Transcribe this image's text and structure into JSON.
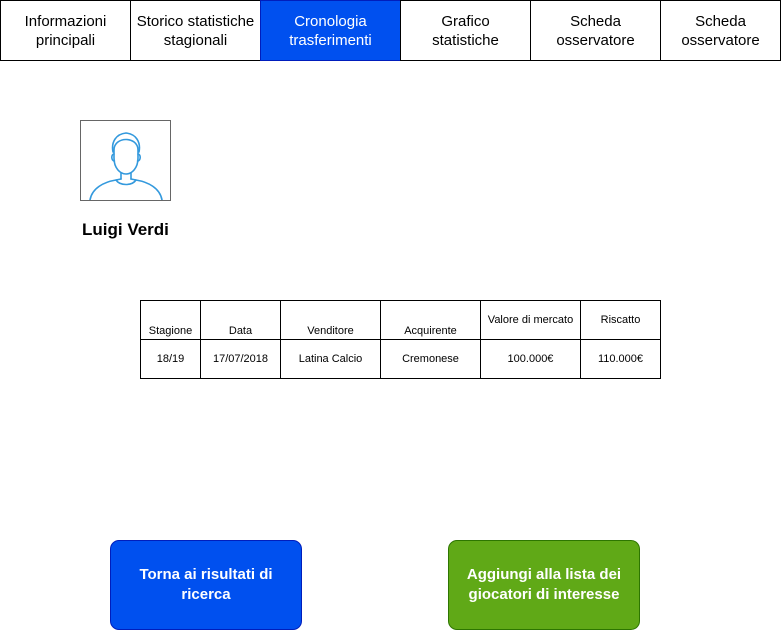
{
  "tabs": [
    {
      "label": "Informazioni\nprincipali"
    },
    {
      "label": "Storico statistiche\nstagionali"
    },
    {
      "label": "Cronologia\ntrasferimenti"
    },
    {
      "label": "Grafico\nstatistiche"
    },
    {
      "label": "Scheda\nosservatore"
    },
    {
      "label": "Scheda\nosservatore"
    }
  ],
  "active_tab": 2,
  "player": {
    "avatar_icon": "user-avatar-icon",
    "name": "Luigi Verdi"
  },
  "table": {
    "headers": [
      "Stagione",
      "Data",
      "Venditore",
      "Acquirente",
      "Valore di mercato",
      "Riscatto"
    ],
    "rows": [
      [
        "18/19",
        "17/07/2018",
        "Latina Calcio",
        "Cremonese",
        "100.000€",
        "110.000€"
      ]
    ]
  },
  "buttons": {
    "back_label": "Torna ai risultati di ricerca",
    "add_label": "Aggiungi alla lista dei giocatori di interesse"
  },
  "colors": {
    "active_tab": "#0050ef",
    "back_button": "#0050ef",
    "add_button": "#60a917",
    "avatar_stroke": "#3399dd"
  }
}
